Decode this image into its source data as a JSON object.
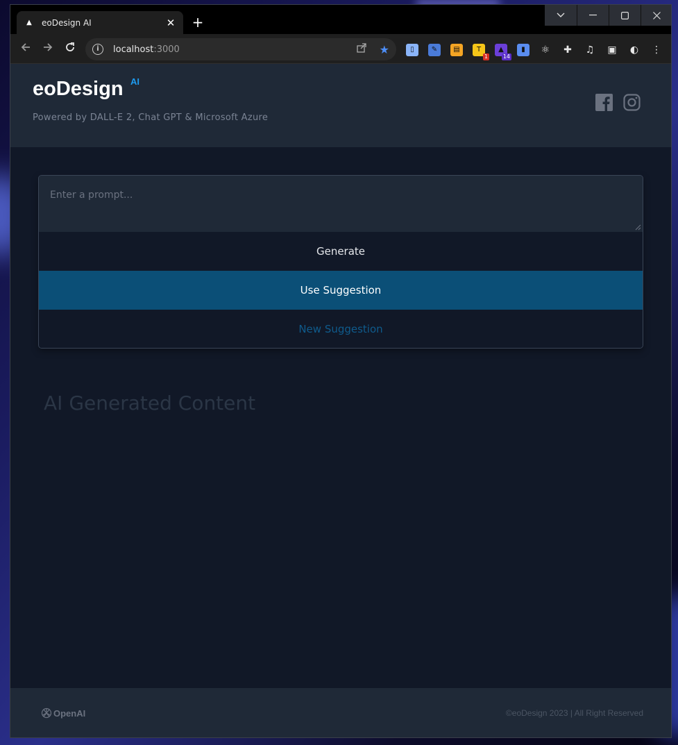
{
  "browser": {
    "tab_title": "eoDesign AI",
    "tab_close": "✕",
    "new_tab": "+",
    "url_host": "localhost",
    "url_port": ":3000",
    "window_controls": {
      "dropdown": "⌄",
      "minimize": "—",
      "maximize": "☐",
      "close": "✕"
    },
    "extensions": [
      {
        "icon": "document-icon",
        "color": "#8ab4f8"
      },
      {
        "icon": "pin-icon",
        "color": "#4a7bd8"
      },
      {
        "icon": "notes-icon",
        "color": "#f5a524"
      },
      {
        "icon": "t-icon",
        "color": "#f5c518",
        "badge": "1"
      },
      {
        "icon": "graduation-icon",
        "color": "#6b3fd8",
        "badge": "14"
      },
      {
        "icon": "tag-icon",
        "color": "#5a8df0"
      },
      {
        "icon": "react-icon",
        "color": "#cccccc"
      },
      {
        "icon": "puzzle-icon",
        "color": "#cccccc"
      },
      {
        "icon": "media-icon",
        "color": "#cccccc"
      },
      {
        "icon": "sidepanel-icon",
        "color": "#cccccc"
      },
      {
        "icon": "edge-icon",
        "color": "#cccccc"
      },
      {
        "icon": "menu-icon",
        "color": "#cccccc"
      }
    ]
  },
  "header": {
    "brand": "eoDesign",
    "brand_sup": "AI",
    "tagline": "Powered by DALL-E 2, Chat GPT & Microsoft Azure",
    "social": [
      "facebook-icon",
      "instagram-icon"
    ]
  },
  "form": {
    "prompt_placeholder": "Enter a prompt...",
    "prompt_value": "",
    "generate_label": "Generate",
    "use_suggestion_label": "Use Suggestion",
    "new_suggestion_label": "New Suggestion"
  },
  "content": {
    "section_title": "AI Generated Content"
  },
  "footer": {
    "openai_label": "OpenAI",
    "copyright": "©eoDesign 2023 | All Right Reserved"
  },
  "colors": {
    "accent": "#1d9bf0",
    "use_suggestion_bg": "#0b4f77",
    "page_bg": "#111827",
    "header_bg": "#1f2937"
  }
}
